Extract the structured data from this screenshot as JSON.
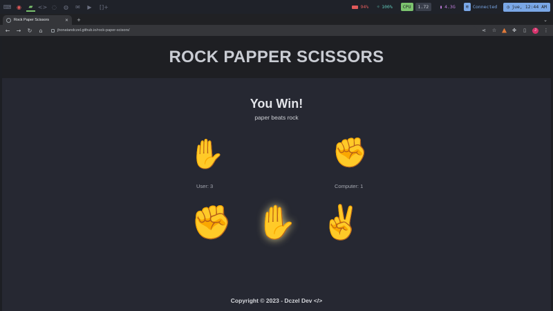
{
  "system_bar": {
    "workspaces": [
      {
        "icon": "terminal-icon",
        "glyph": "⌨"
      },
      {
        "icon": "firefox-icon",
        "glyph": "◉"
      },
      {
        "icon": "folder-icon",
        "glyph": "▰"
      },
      {
        "icon": "code-icon",
        "glyph": "<>"
      },
      {
        "icon": "chat-icon",
        "glyph": "◌"
      },
      {
        "icon": "discord-icon",
        "glyph": "◍"
      },
      {
        "icon": "mail-icon",
        "glyph": "✉"
      },
      {
        "icon": "video-icon",
        "glyph": "▶"
      }
    ],
    "layout_indicator": "[]+",
    "battery": "94%",
    "brightness": "100%",
    "cpu_label": "CPU",
    "cpu_value": "1.72",
    "memory": "4.3G",
    "wifi_status": "Connected",
    "datetime": "jue, 12:44 AM"
  },
  "browser": {
    "tab_title": "Rock Paper Scissors",
    "url": "jhonatandczel.github.io/rock-paper-scisors/",
    "profile_initial": "J"
  },
  "page": {
    "site_title": "ROCK PAPPER SCISSORS",
    "result_title": "You Win!",
    "result_description": "paper beats rock",
    "user_choice_icon": "✋",
    "computer_choice_icon": "✊",
    "user_score": "User: 3",
    "computer_score": "Computer: 1",
    "options": [
      {
        "name": "rock",
        "icon": "✊",
        "selected": false
      },
      {
        "name": "paper",
        "icon": "✋",
        "selected": true
      },
      {
        "name": "scissors",
        "icon": "✌️",
        "selected": false
      }
    ],
    "footer": "Copyright © 2023 - Dczel Dev </>"
  },
  "colors": {
    "page_background": "#262832",
    "header_background": "#1e1f23",
    "title_text": "#c9ccd3",
    "accent_green": "#7cc36e",
    "accent_blue": "#7aa7e6"
  }
}
